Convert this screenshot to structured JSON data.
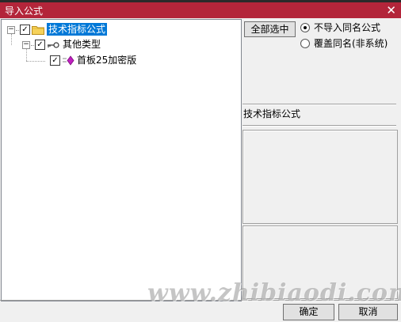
{
  "window": {
    "title": "导入公式",
    "close_glyph": "✕"
  },
  "tree": {
    "root": {
      "label": "技术指标公式",
      "checked": true,
      "expander": "−"
    },
    "child": {
      "label": "其他类型",
      "checked": true,
      "expander": "−"
    },
    "leaf": {
      "label": "首板25加密版",
      "checked": true
    }
  },
  "options": {
    "select_all_label": "全部选中",
    "radios": [
      {
        "label": "不导入同名公式",
        "selected": true
      },
      {
        "label": "覆盖同名(非系统)",
        "selected": false
      }
    ]
  },
  "info": {
    "category_label": "技术指标公式"
  },
  "watermark": "www.zhibiaodi.com",
  "footer": {
    "ok_label": "确定",
    "cancel_label": "取消"
  },
  "colors": {
    "titlebar": "#b3253a",
    "selection": "#0078d7",
    "leaf_icon": "#c020c0"
  }
}
